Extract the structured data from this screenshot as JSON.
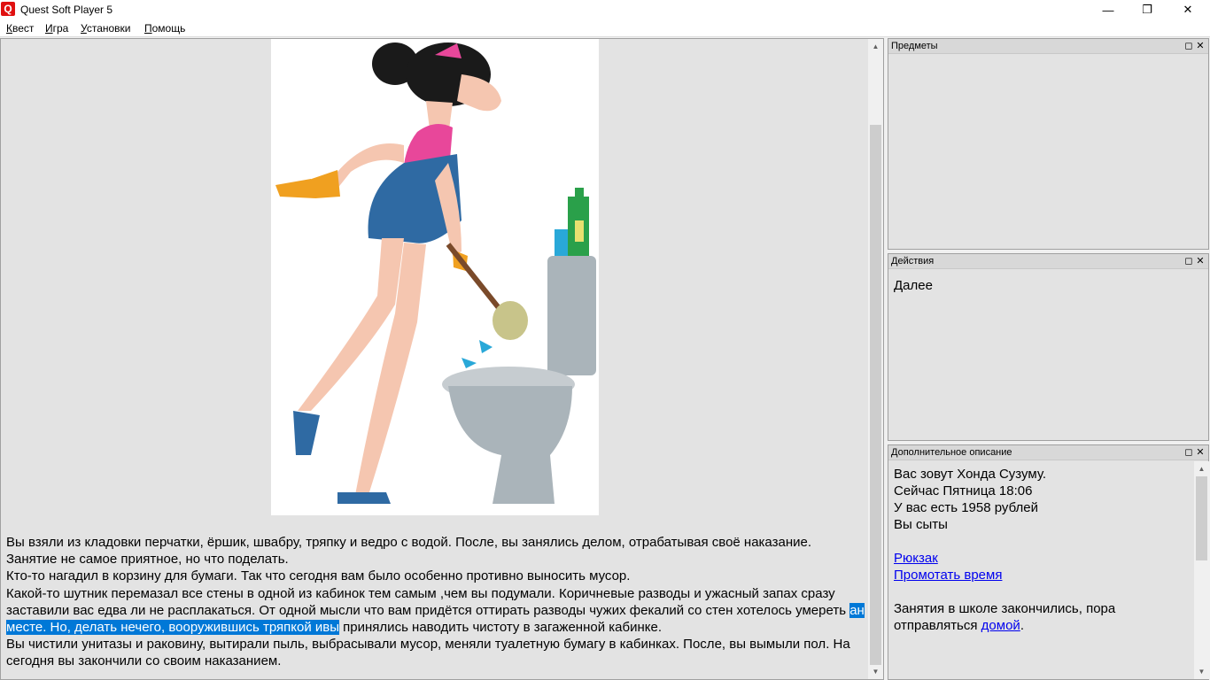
{
  "window": {
    "app_icon_letter": "Q",
    "title": "Quest Soft Player 5",
    "minimize_glyph": "—",
    "maximize_glyph": "❐",
    "close_glyph": "✕"
  },
  "menu": [
    {
      "label": "Квест",
      "accel": "К",
      "rest": "вест"
    },
    {
      "label": "Игра",
      "accel": "И",
      "rest": "гра"
    },
    {
      "label": "Установки",
      "accel": "У",
      "rest": "становки"
    },
    {
      "label": "Помощь",
      "accel": "П",
      "rest": "омощь"
    }
  ],
  "main": {
    "illustration": "woman-cleaning-toilet",
    "story": {
      "p1": "Вы взяли из кладовки перчатки, ёршик, швабру, тряпку и ведро с водой. После, вы занялись делом, отрабатывая своё наказание.",
      "p2": "Занятие не самое приятное, но что поделать.",
      "p3": "Кто-то нагадил в корзину для бумаги. Так что сегодня вам было особенно противно выносить мусор.",
      "p4_before": "Какой-то шутник перемазал все стены в одной из кабинок тем самым ,чем вы подумали. Коричневые разводы и ужасный запах сразу заставили вас едва ли не расплакаться. От одной мысли что вам придётся оттирать разводы чужих фекалий со стен хотелось умереть ",
      "p4_selected": "ан месте. Но, делать нечего, вооружившись тряпкой ивы",
      "p4_after": " принялись наводить чистоту в загаженной кабинке.",
      "p5": "Вы чистили унитазы и раковину, вытирали пыль, выбрасывали мусор, меняли туалетную бумагу в кабинках. После, вы вымыли пол. На сегодня вы закончили со своим наказанием."
    }
  },
  "panels": {
    "items": {
      "title": "Предметы"
    },
    "actions": {
      "title": "Действия",
      "list": [
        "Далее"
      ]
    },
    "extra": {
      "title": "Дополнительное описание",
      "line1": "Вас зовут Хонда Сузуму.",
      "line2": "Сейчас Пятница 18:06",
      "line3": "У вас есть 1958 рублей",
      "line4": "Вы сыты",
      "link_backpack": "Рюкзак",
      "link_skip_time": "Промотать время",
      "note_before": "Занятия в школе закончились, пора отправляться ",
      "note_link": "домой",
      "note_after": "."
    },
    "btn_restore": "◻",
    "btn_close": "✕"
  },
  "colors": {
    "selection": "#0078d7",
    "link": "#0000ee",
    "app_icon": "#e01010"
  }
}
